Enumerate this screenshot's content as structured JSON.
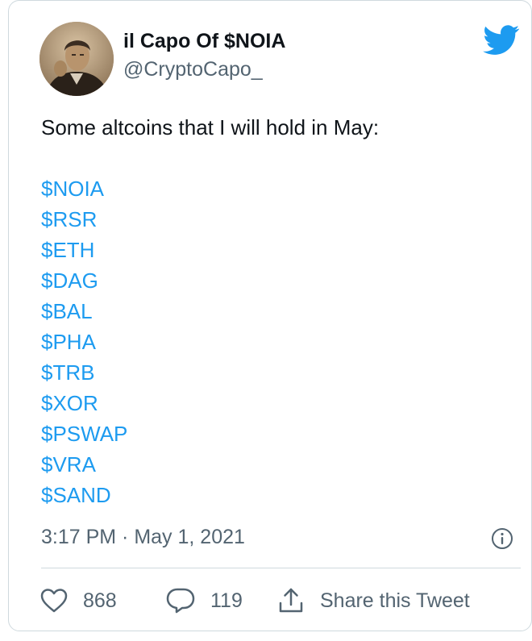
{
  "author": {
    "display_name": "il Capo Of $NOIA",
    "handle": "@CryptoCapo_"
  },
  "tweet": {
    "text": "Some altcoins that I will hold in May:",
    "tickers": [
      "$NOIA",
      "$RSR",
      "$ETH",
      "$DAG",
      "$BAL",
      "$PHA",
      "$TRB",
      "$XOR",
      "$PSWAP",
      "$VRA",
      "$SAND"
    ],
    "timestamp": "3:17 PM · May 1, 2021"
  },
  "actions": {
    "likes": "868",
    "replies": "119",
    "share_label": "Share this Tweet"
  },
  "icons": {
    "brand": "twitter-bird-icon",
    "info": "info-icon",
    "like": "heart-icon",
    "reply": "reply-bubble-icon",
    "share": "share-arrow-icon"
  },
  "colors": {
    "link": "#1d9bf0",
    "text": "#0f1419",
    "muted": "#536471",
    "brand": "#1d9bf0",
    "border": "#cfd9de"
  }
}
